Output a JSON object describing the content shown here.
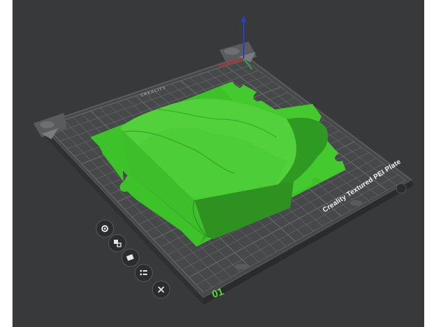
{
  "viewport": {
    "background": "#38393b"
  },
  "plate": {
    "name": "Creality Textured PEI Plate",
    "brand": "CREALITY",
    "index": "01",
    "grid_color": "#6a6b6d",
    "base_color": "#47484a"
  },
  "model": {
    "color": "#3ec22a",
    "top_color": "#4fd63b",
    "side_color": "#35a624"
  },
  "axes": {
    "x_color": "#c8262b",
    "y_color": "#2aa84a",
    "z_color": "#2540c8"
  },
  "toolbar": {
    "items": [
      {
        "name": "settings",
        "icon": "gear-icon"
      },
      {
        "name": "arrange",
        "icon": "arrange-icon"
      },
      {
        "name": "auto-orient",
        "icon": "orient-icon"
      },
      {
        "name": "plate-settings",
        "icon": "list-icon"
      },
      {
        "name": "delete-plate",
        "icon": "close-icon"
      }
    ]
  }
}
